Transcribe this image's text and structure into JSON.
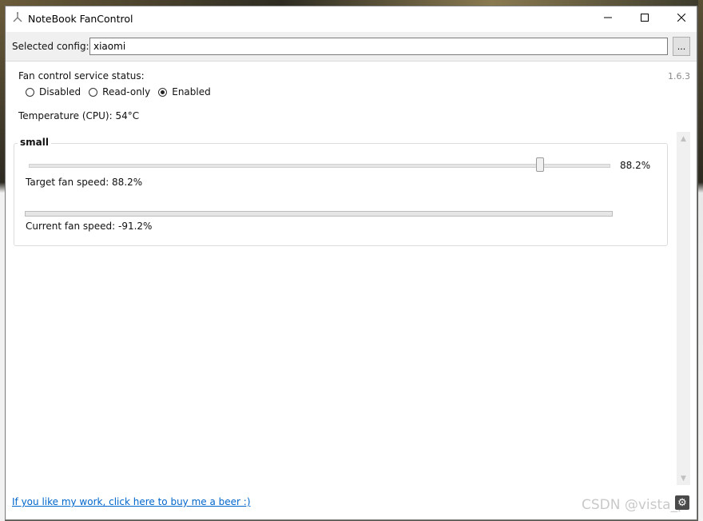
{
  "window": {
    "title": "NoteBook FanControl",
    "version": "1.6.3"
  },
  "config": {
    "label": "Selected config:",
    "value": "xiaomi",
    "browse_label": "..."
  },
  "service": {
    "label": "Fan control service status:",
    "options": [
      {
        "label": "Disabled",
        "selected": false
      },
      {
        "label": "Read-only",
        "selected": false
      },
      {
        "label": "Enabled",
        "selected": true
      }
    ]
  },
  "temperature": {
    "text": "Temperature (CPU):  54°C"
  },
  "fan": {
    "name": "small",
    "slider_value_text": "88.2%",
    "slider_fraction": 0.882,
    "target_text": "Target fan speed:  88.2%",
    "current_text": "Current fan speed:  -91.2%",
    "current_fraction": 0
  },
  "footer": {
    "link_text": "If you like my work, click here to buy me a beer :)",
    "watermark": "CSDN @vista_p"
  },
  "colors": {
    "link": "#0066cc",
    "progress_fill": "#06b025"
  },
  "icons": {
    "app": "fan-icon",
    "minimize": "minimize-icon",
    "maximize": "maximize-icon",
    "close": "close-icon",
    "settings": "gear-icon"
  }
}
